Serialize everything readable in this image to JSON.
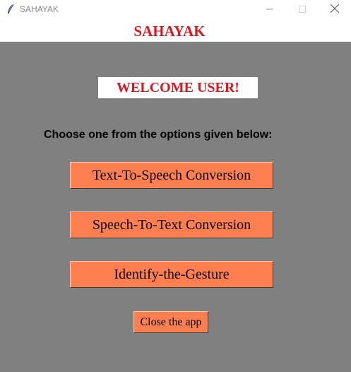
{
  "window": {
    "title": "SAHAYAK",
    "app_icon": "feather-icon",
    "controls": {
      "minimize_icon": "minimize-icon",
      "maximize_icon": "maximize-icon",
      "close_icon": "close-icon"
    }
  },
  "header": {
    "heading": "SAHAYAK"
  },
  "main": {
    "welcome": "WELCOME USER!",
    "instruction": "Choose one from the options given below:",
    "options": [
      {
        "label": "Text-To-Speech Conversion"
      },
      {
        "label": "Speech-To-Text Conversion"
      },
      {
        "label": "Identify-the-Gesture"
      }
    ],
    "close_label": "Close the app"
  },
  "colors": {
    "background": "#808080",
    "heading": "#e8121b",
    "button": "#ff7f50",
    "welcome_box": "#ffffff"
  }
}
